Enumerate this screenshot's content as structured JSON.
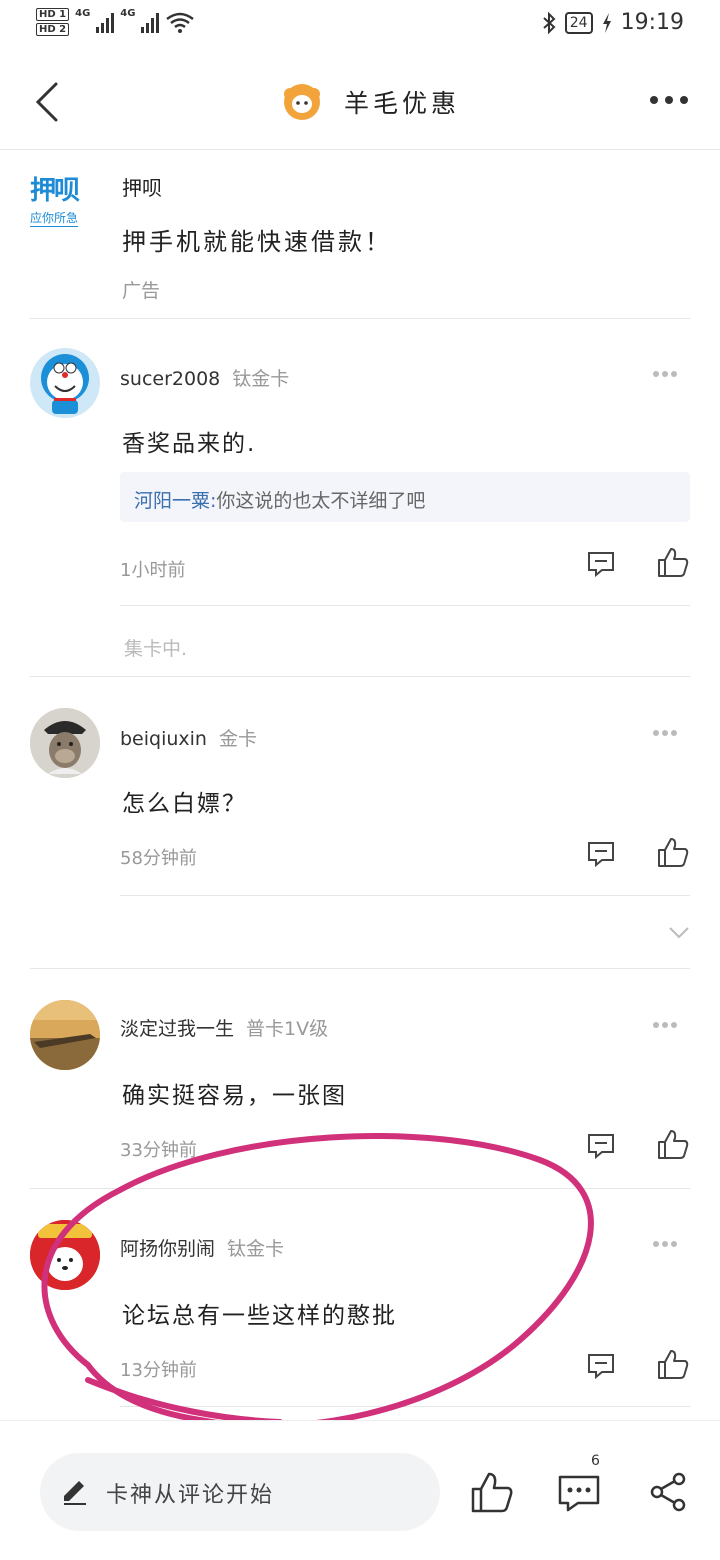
{
  "status_bar": {
    "hd1": "HD 1",
    "hd2": "HD 2",
    "net1": "4G",
    "net2": "4G",
    "battery": "24",
    "time": "19:19"
  },
  "header": {
    "title": "羊毛优惠",
    "back_icon": "chevron-left-icon",
    "more_icon": "more-dots-icon",
    "logo_icon": "sheep-icon"
  },
  "ad": {
    "logo_line1": "押呗",
    "logo_line2": "应你所急",
    "name": "押呗",
    "text": "押手机就能快速借款！",
    "tag": "广告"
  },
  "comments": [
    {
      "username": "sucer2008",
      "level": "钛金卡",
      "text": "香奖品来的.",
      "reply": {
        "user": "河阳一粟:",
        "text": "你这说的也太不详细了吧"
      },
      "time": "1小时前",
      "reply_more": "集卡中."
    },
    {
      "username": "beiqiuxin",
      "level": "金卡",
      "text": "怎么白嫖？",
      "time": "58分钟前"
    },
    {
      "username": "淡定过我一生",
      "level": "普卡1V级",
      "text": "确实挺容易，一张图",
      "time": "33分钟前"
    },
    {
      "username": "阿扬你别闹",
      "level": "钛金卡",
      "text": "论坛总有一些这样的憨批",
      "time": "13分钟前"
    }
  ],
  "bottom_bar": {
    "input_placeholder": "卡神从评论开始",
    "comment_count": "6"
  },
  "colors": {
    "accent_blue": "#3a6fb0",
    "sheep_orange": "#f2a43a",
    "annotation_pink": "#d1307a"
  }
}
